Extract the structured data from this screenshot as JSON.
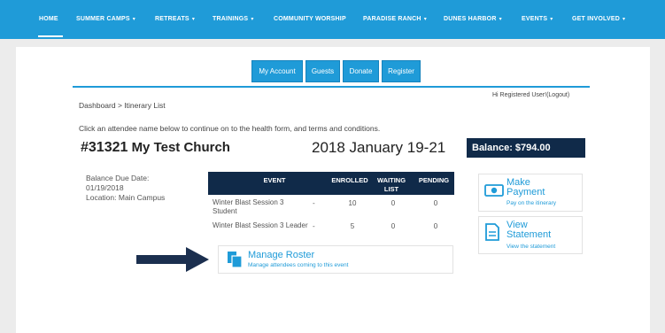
{
  "nav": {
    "items": [
      {
        "label": "HOME",
        "caret": ""
      },
      {
        "label": "SUMMER CAMPS",
        "caret": "▾"
      },
      {
        "label": "RETREATS",
        "caret": "▾"
      },
      {
        "label": "TRAININGS",
        "caret": "▾"
      },
      {
        "label": "COMMUNITY WORSHIP",
        "caret": ""
      },
      {
        "label": "PARADISE RANCH",
        "caret": "▾"
      },
      {
        "label": "DUNES HARBOR",
        "caret": "▾"
      },
      {
        "label": "EVENTS",
        "caret": "▾"
      },
      {
        "label": "GET INVOLVED",
        "caret": "▾"
      }
    ]
  },
  "buttons": {
    "my_account": "My Account",
    "guests": "Guests",
    "donate": "Donate",
    "register": "Register"
  },
  "breadcrumb": "Dashboard > Itinerary List",
  "greeting": {
    "text": "Hi  Registered User!",
    "logout": "(Logout)"
  },
  "instruction": "Click an attendee name below to continue on to the health form, and terms and conditions.",
  "church": {
    "number": "#31321",
    "name": "My Test Church"
  },
  "event_date": "2018 January 19-21",
  "balance": "Balance: $794.00",
  "meta": {
    "due_label": "Balance Due Date:",
    "due_date": "01/19/2018",
    "location": "Location: Main Campus"
  },
  "table": {
    "headers": {
      "event": "EVENT",
      "enrolled": "ENROLLED",
      "waiting": "WAITING LIST",
      "pending": "PENDING"
    },
    "rows": [
      {
        "event": "Winter Blast Session 3 Student",
        "dash": "-",
        "enrolled": "10",
        "waiting": "0",
        "pending": "0"
      },
      {
        "event": "Winter Blast Session 3 Leader",
        "dash": "-",
        "enrolled": "5",
        "waiting": "0",
        "pending": "0"
      }
    ]
  },
  "roster": {
    "title": "Manage Roster",
    "subtitle": "Manage attendees coming to this event"
  },
  "actions": {
    "payment": {
      "title_line1": "Make",
      "title_line2": "Payment",
      "subtitle": "Pay on the itinerary"
    },
    "statement": {
      "title_line1": "View",
      "title_line2": "Statement",
      "subtitle": "View the statement"
    }
  },
  "colors": {
    "accent": "#1f9bd8",
    "navy": "#102a49",
    "arrow": "#1b2f4f"
  },
  "icons": [
    "chevron-down-icon",
    "copy-roster-icon",
    "money-icon",
    "document-icon",
    "right-arrow-icon"
  ]
}
